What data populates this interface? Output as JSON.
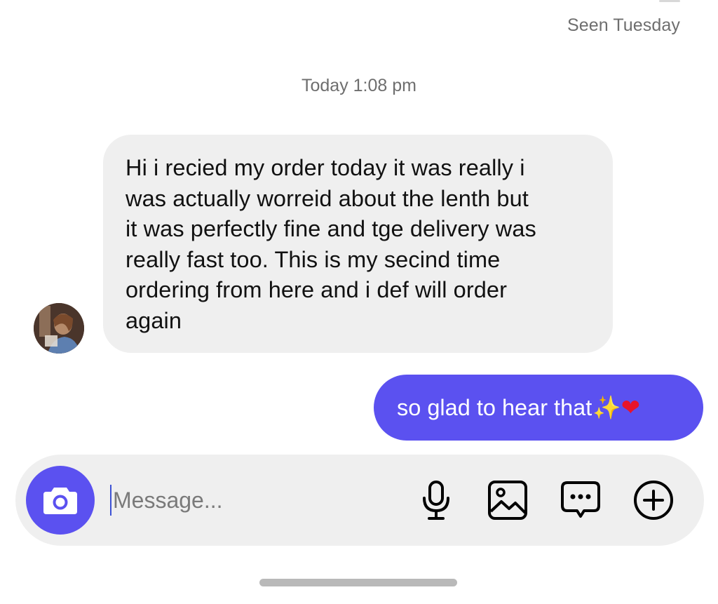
{
  "thread": {
    "seen_status": "Seen Tuesday",
    "timestamp": "Today 1:08 pm"
  },
  "messages": [
    {
      "sender": "other",
      "lines": [
        "Hi i recied my order today it was really i",
        "was actually worreid about the lenth but",
        "it was perfectly fine and tge delivery was",
        "really fast too. This is my secind time",
        "ordering from here and i def will order",
        "again"
      ]
    },
    {
      "sender": "me",
      "text": "so glad to hear that",
      "emoji_sparkle": "✨",
      "emoji_heart": "❤"
    }
  ],
  "composer": {
    "placeholder": "Message..."
  },
  "icons": {
    "camera": "camera-icon",
    "mic": "microphone-icon",
    "gallery": "image-gallery-icon",
    "sticker": "sticker-chat-icon",
    "plus": "plus-circle-icon"
  },
  "colors": {
    "accent": "#5b51f0",
    "incoming_bubble": "#efefef",
    "meta_text": "#6e6e6e"
  }
}
